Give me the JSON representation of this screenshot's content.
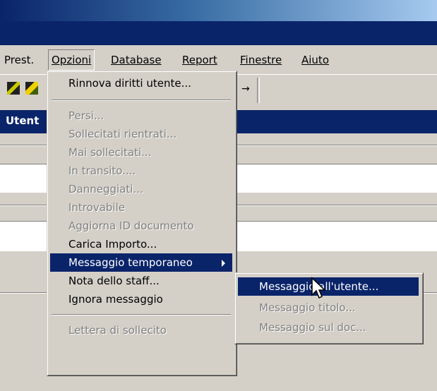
{
  "menubar": {
    "items": [
      {
        "label": "Prest.",
        "mnemonic": ""
      },
      {
        "label": "Opzioni",
        "mnemonic": "O"
      },
      {
        "label": "Database",
        "mnemonic": "D"
      },
      {
        "label": "Report",
        "mnemonic": "R"
      },
      {
        "label": "Finestre",
        "mnemonic": "F"
      },
      {
        "label": "Aiuto",
        "mnemonic": "A"
      }
    ]
  },
  "panel": {
    "label": "Utent"
  },
  "opzioni_menu": {
    "items": [
      {
        "label": "Rinnova diritti utente...",
        "enabled": true
      },
      {
        "label": "Persi...",
        "enabled": false
      },
      {
        "label": "Sollecitati rientrati...",
        "enabled": false
      },
      {
        "label": "Mai sollecitati...",
        "enabled": false
      },
      {
        "label": "In transito....",
        "enabled": false
      },
      {
        "label": "Danneggiati...",
        "enabled": false
      },
      {
        "label": "Introvabile",
        "enabled": false
      },
      {
        "label": "Aggiorna ID documento",
        "enabled": false
      },
      {
        "label": "Carica Importo...",
        "enabled": true
      },
      {
        "label": "Messaggio temporaneo",
        "enabled": true,
        "highlighted": true,
        "submenu": true
      },
      {
        "label": "Nota dello staff...",
        "enabled": true
      },
      {
        "label": "Ignora messaggio",
        "enabled": true
      },
      {
        "label": "Lettera di sollecito",
        "enabled": false
      }
    ]
  },
  "submenu": {
    "items": [
      {
        "label": "Messaggio all'utente...",
        "enabled": true,
        "highlighted": true
      },
      {
        "label": "Messaggio titolo...",
        "enabled": false
      },
      {
        "label": "Messaggio sul doc...",
        "enabled": false
      }
    ]
  },
  "colors": {
    "highlight": "#0a246a",
    "face": "#d4d0c8",
    "disabled": "#808080"
  }
}
